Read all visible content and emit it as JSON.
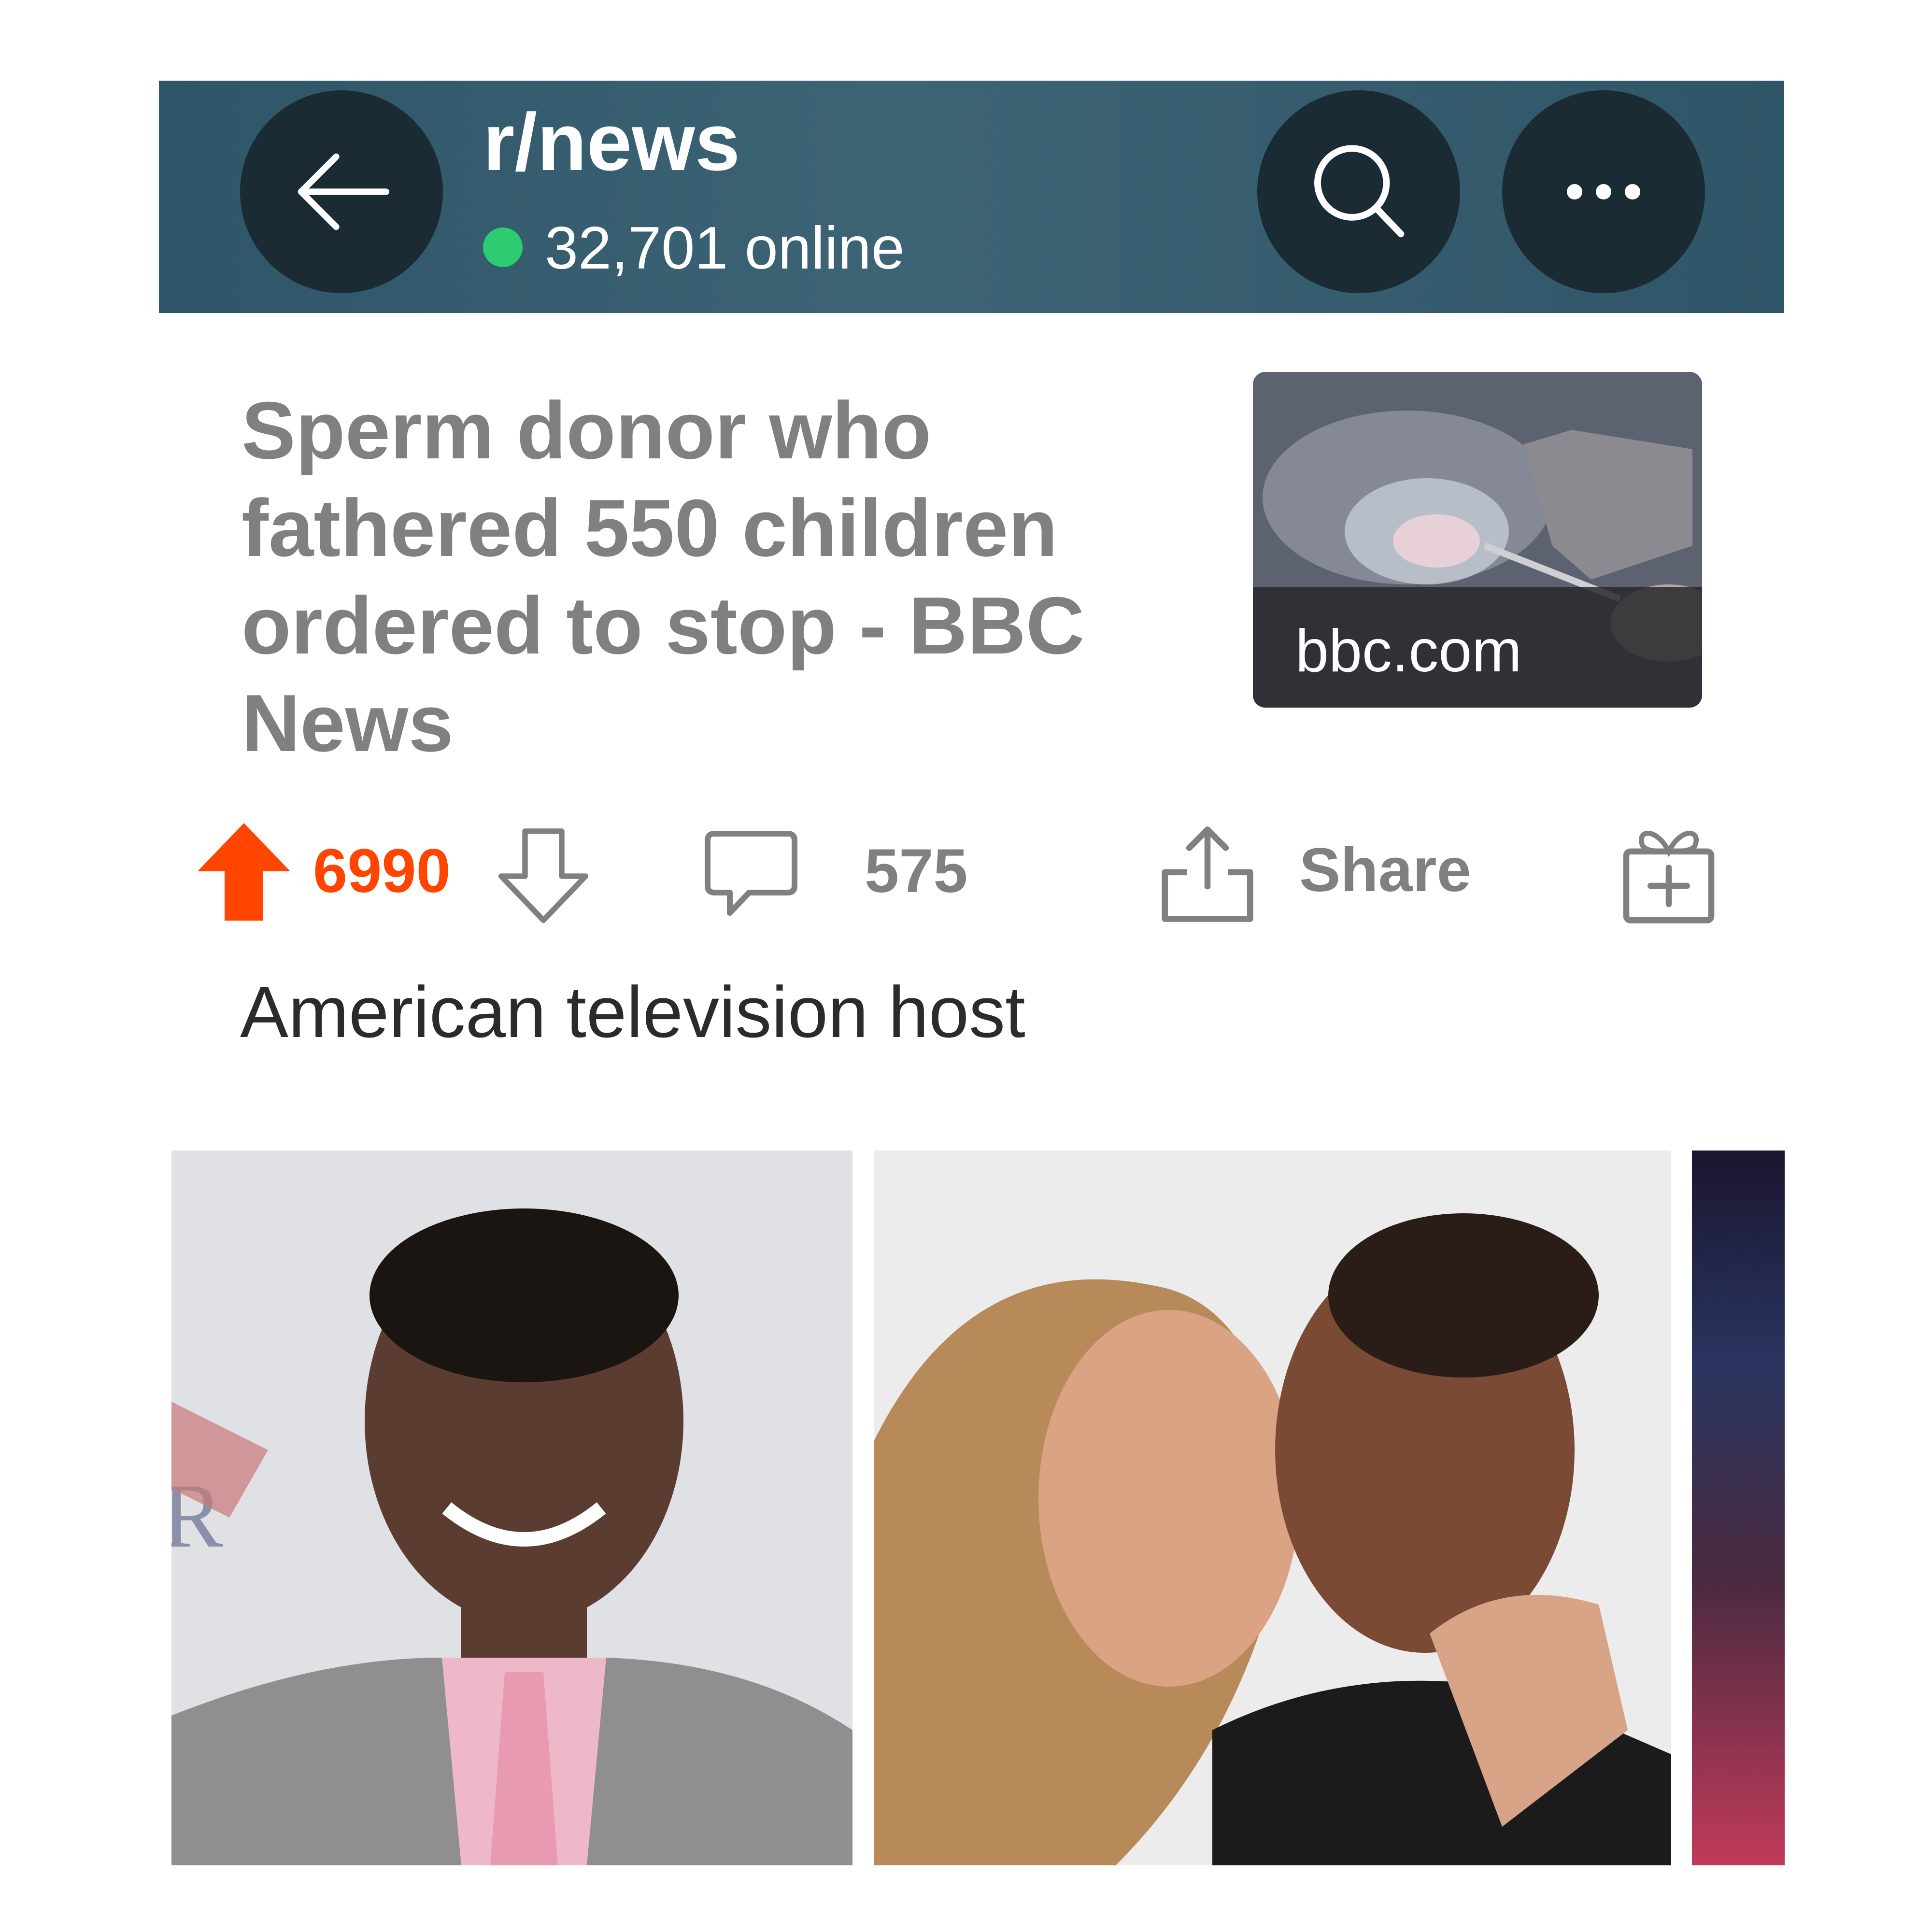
{
  "header": {
    "subreddit": "r/news",
    "online_count": "32,701 online",
    "online_color": "#2ecc71",
    "back_icon": "arrow-left-icon",
    "search_icon": "search-icon",
    "more_icon": "more-horizontal-icon"
  },
  "post": {
    "title": "Sperm donor who fathered 550 children ordered to stop - BBC News",
    "thumbnail_domain": "bbc.com",
    "upvotes": "6990",
    "upvote_color": "#ff4500",
    "comments": "575",
    "share_label": "Share",
    "gift_icon": "gift-award-icon"
  },
  "caption": "American television host",
  "images": [
    {
      "description_icon": "portrait-photo"
    },
    {
      "description_icon": "couple-photo"
    },
    {
      "description_icon": "partial-photo"
    }
  ]
}
